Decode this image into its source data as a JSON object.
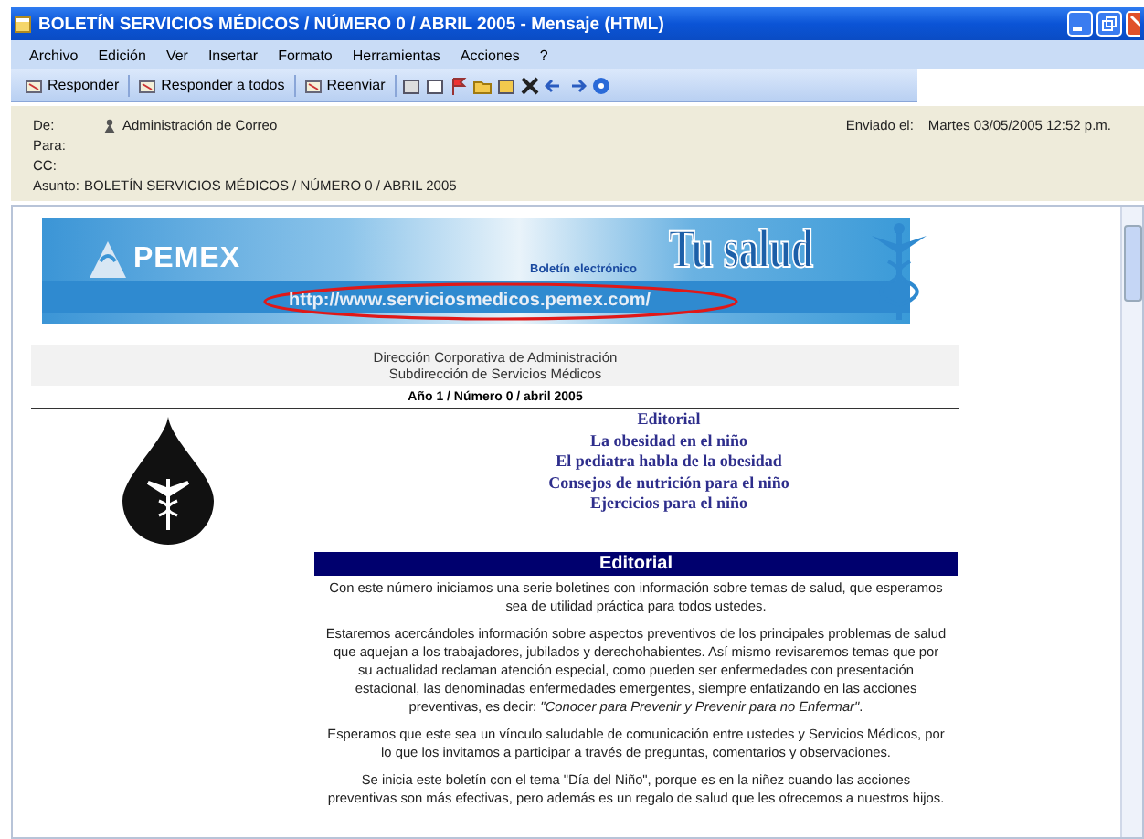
{
  "window": {
    "title": "BOLETÍN SERVICIOS MÉDICOS / NÚMERO 0 / ABRIL 2005 - Mensaje (HTML)"
  },
  "menu": [
    "Archivo",
    "Edición",
    "Ver",
    "Insertar",
    "Formato",
    "Herramientas",
    "Acciones",
    "?"
  ],
  "toolbar": {
    "buttons": [
      "Responder",
      "Responder a todos",
      "Reenviar"
    ]
  },
  "header": {
    "fields": [
      {
        "label": "De:",
        "value": "Administración de Correo"
      },
      {
        "label": "Para:"
      },
      {
        "label": "CC:"
      },
      {
        "label": "Asunto:",
        "value": "BOLETÍN SERVICIOS MÉDICOS / NÚMERO 0 / ABRIL 2005"
      }
    ],
    "sent": {
      "label": "Enviado el:",
      "value": "Martes 03/05/2005 12:52 p.m."
    }
  },
  "newsletter": {
    "banner": {
      "brand": "PEMEX",
      "subtitle": "Boletín electrónico",
      "title": "Tu salud",
      "url": "http://www.serviciosmedicos.pemex.com/"
    },
    "org": [
      "Dirección Corporativa de Administración",
      "Subdirección de Servicios Médicos"
    ],
    "issue": "Año 1 / Número 0 / abril 2005",
    "links": [
      "Editorial",
      "La obesidad en el niño",
      "El pediatra habla de la obesidad",
      "Consejos de nutrición para el niño",
      "Ejercicios para el niño"
    ],
    "section": {
      "heading": "Editorial",
      "paragraphs": [
        "Con este número iniciamos una serie boletines con información sobre temas de salud, que esperamos sea de utilidad práctica para todos ustedes.",
        "Estaremos acercándoles información sobre aspectos preventivos de los principales problemas de salud que aquejan a los trabajadores, jubilados y derechohabientes. Así mismo revisaremos temas que por su actualidad reclaman atención especial, como pueden ser enfermedades con presentación estacional, las denominadas enfermedades emergentes, siempre enfatizando en las acciones preventivas, es decir: *\"Conocer para Prevenir y Prevenir para no Enfermar\"*.",
        "Esperamos que este sea un vínculo saludable de comunicación entre ustedes y Servicios Médicos, por lo que los invitamos a participar a través de preguntas, comentarios y observaciones.",
        "Se inicia este boletín con el tema \"Día del Niño\", porque es en la niñez cuando las acciones preventivas son más efectivas, pero además es un regalo de salud que les ofrecemos a nuestros hijos."
      ]
    }
  }
}
